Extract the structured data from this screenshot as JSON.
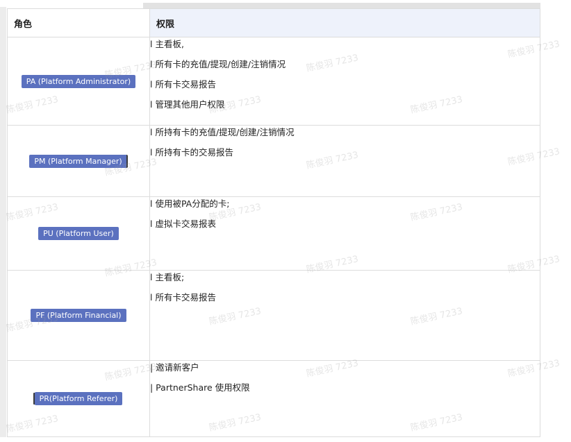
{
  "table": {
    "header": {
      "role": "角色",
      "permissions": "权限"
    },
    "rows": [
      {
        "role": "PA (Platform Administrator)",
        "permissions": [
          "l 主看板,",
          "l 所有卡的充值/提现/创建/注销情况",
          "l 所有卡交易报告",
          "l 管理其他用户权限"
        ]
      },
      {
        "role": "PM (Platform Manager)",
        "permissions": [
          "l 所持有卡的充值/提现/创建/注销情况",
          "l 所持有卡的交易报告"
        ]
      },
      {
        "role": "PU (Platform User)",
        "permissions": [
          "l 使用被PA分配的卡;",
          "l 虚拟卡交易报表"
        ]
      },
      {
        "role": "PF (Platform Financial)",
        "permissions": [
          "l 主看板;",
          "l 所有卡交易报告"
        ]
      },
      {
        "role": "PR(Platform Referer)",
        "permissions": [
          "| 邀请新客户",
          "| PartnerShare 使用权限"
        ]
      }
    ]
  },
  "watermark": {
    "text": "陈俊羽 7233"
  },
  "colors": {
    "badge": "#5b71bf",
    "header_bg": "#eef2fb",
    "border": "#dcdcdc"
  }
}
